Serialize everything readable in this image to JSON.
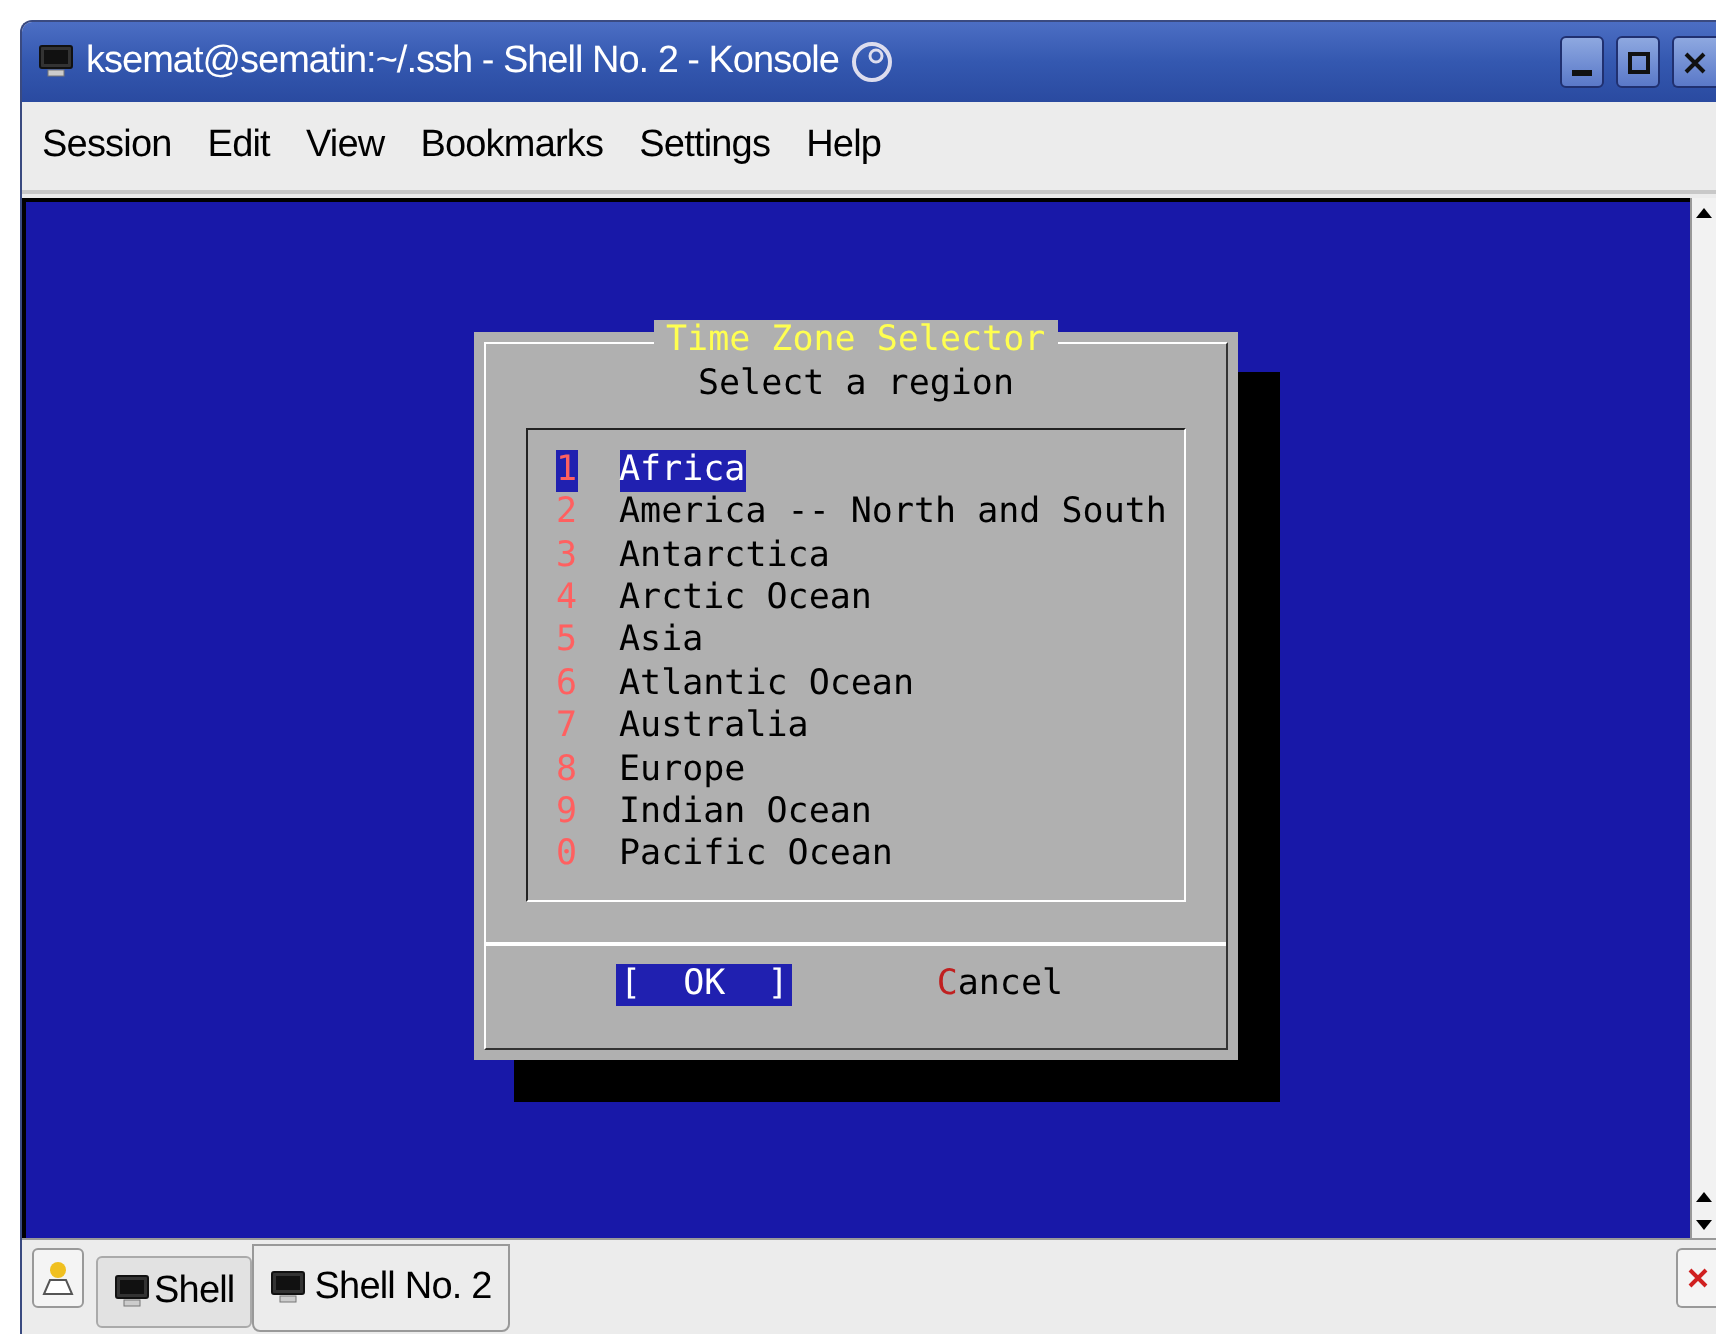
{
  "window": {
    "title": "ksemat@sematin:~/.ssh - Shell No. 2 - Konsole"
  },
  "menu": [
    "Session",
    "Edit",
    "View",
    "Bookmarks",
    "Settings",
    "Help"
  ],
  "dialog": {
    "title": "Time Zone Selector",
    "prompt": "Select a region",
    "items": [
      {
        "key": "1",
        "label": "Africa",
        "selected": true
      },
      {
        "key": "2",
        "label": "America -- North and South",
        "selected": false
      },
      {
        "key": "3",
        "label": "Antarctica",
        "selected": false
      },
      {
        "key": "4",
        "label": "Arctic Ocean",
        "selected": false
      },
      {
        "key": "5",
        "label": "Asia",
        "selected": false
      },
      {
        "key": "6",
        "label": "Atlantic Ocean",
        "selected": false
      },
      {
        "key": "7",
        "label": "Australia",
        "selected": false
      },
      {
        "key": "8",
        "label": "Europe",
        "selected": false
      },
      {
        "key": "9",
        "label": "Indian Ocean",
        "selected": false
      },
      {
        "key": "0",
        "label": "Pacific Ocean",
        "selected": false
      }
    ],
    "buttons": [
      {
        "label": "[  OK  ]",
        "selected": true
      },
      {
        "label": "Cancel",
        "selected": false
      }
    ]
  },
  "tabs": [
    {
      "label": "Shell",
      "selected": false
    },
    {
      "label": "Shell No. 2",
      "selected": true
    }
  ]
}
